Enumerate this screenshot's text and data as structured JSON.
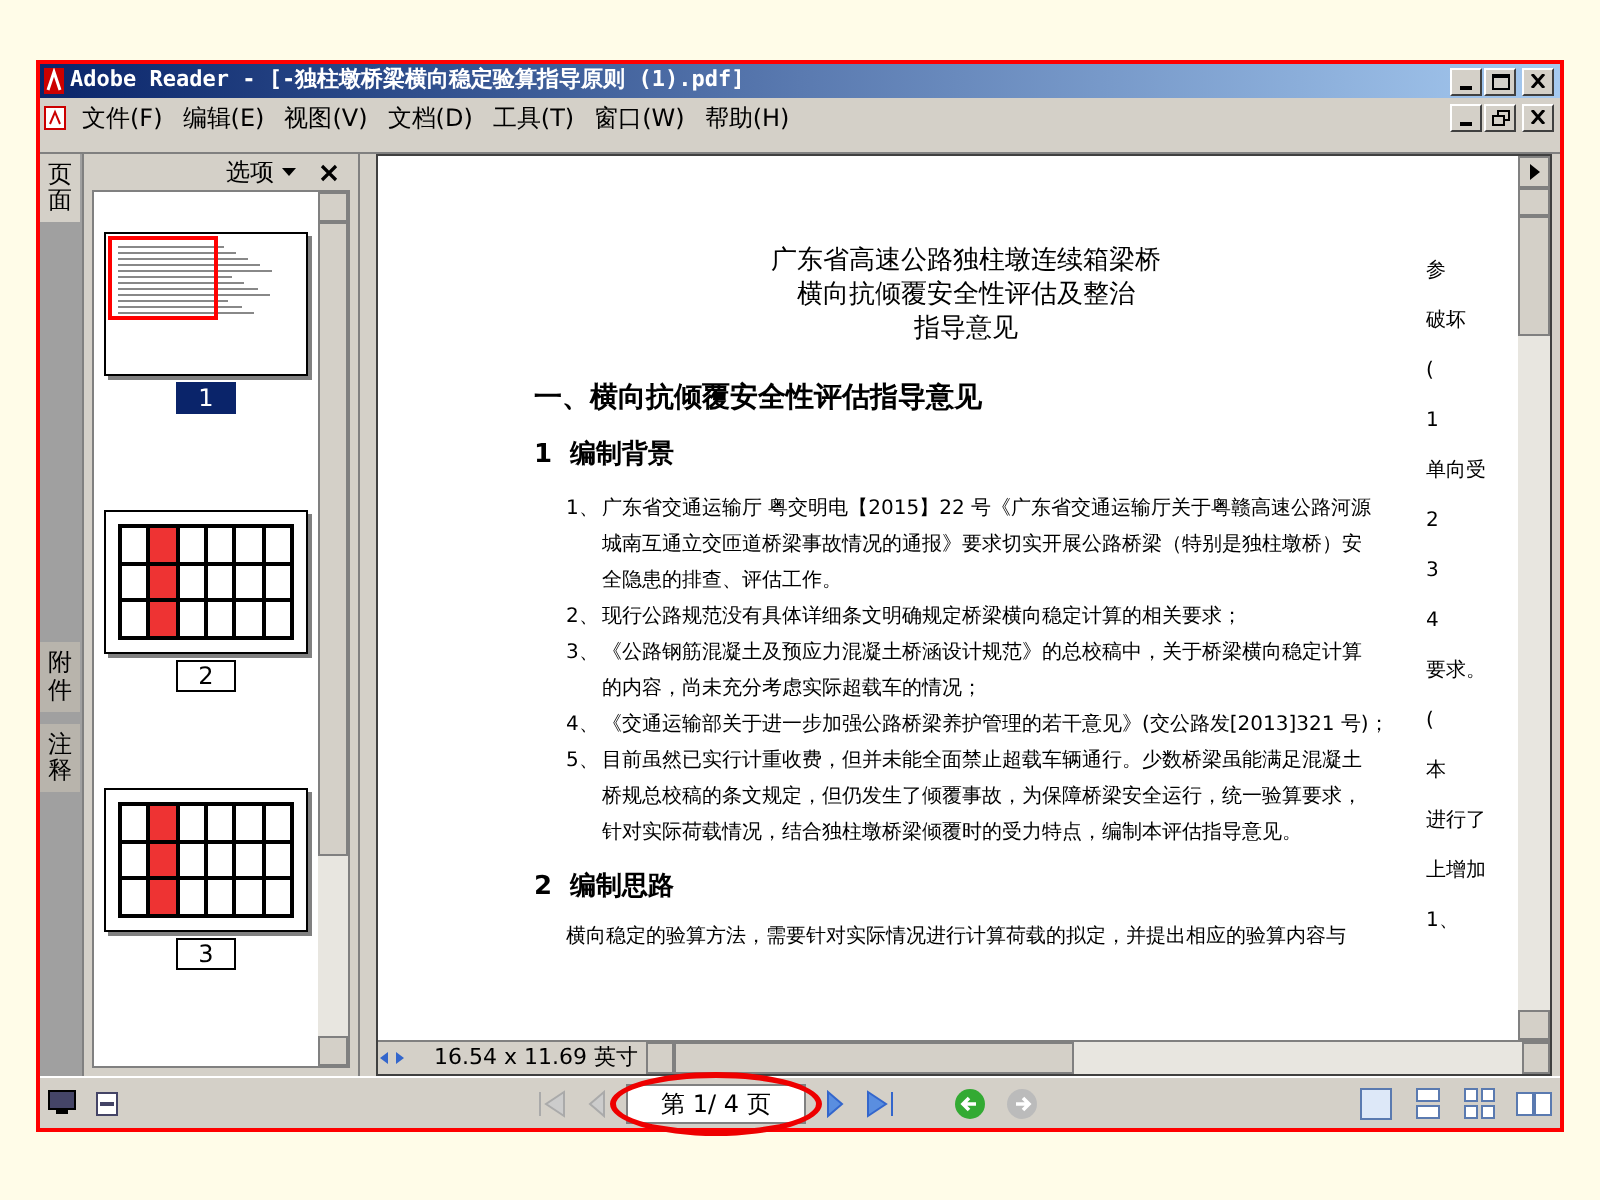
{
  "window": {
    "title": "Adobe Reader - [-独柱墩桥梁横向稳定验算指导原则 (1).pdf]"
  },
  "menu": {
    "items": [
      "文件(F)",
      "编辑(E)",
      "视图(V)",
      "文档(D)",
      "工具(T)",
      "窗口(W)",
      "帮助(H)"
    ]
  },
  "sidebar": {
    "tabs": [
      {
        "label": "页面",
        "selected": true
      },
      {
        "label": "附件",
        "selected": false
      },
      {
        "label": "注释",
        "selected": false
      }
    ],
    "options": "选项",
    "thumbnails": [
      {
        "label": "1",
        "selected": true,
        "kind": "text"
      },
      {
        "label": "2",
        "selected": false,
        "kind": "table"
      },
      {
        "label": "3",
        "selected": false,
        "kind": "table"
      }
    ]
  },
  "document": {
    "title_lines": [
      "广东省高速公路独柱墩连续箱梁桥",
      "横向抗倾覆安全性评估及整治",
      "指导意见"
    ],
    "heading": "一、横向抗倾覆安全性评估指导意见",
    "section_1": "1  编制背景",
    "items": [
      {
        "number": "1、",
        "lines": [
          "广东省交通运输厅 粤交明电【2015】22 号《广东省交通运输厅关于粤赣高速公路河源",
          "城南互通立交匝道桥梁事故情况的通报》要求切实开展公路桥梁（特别是独柱墩桥）安",
          "全隐患的排查、评估工作。"
        ]
      },
      {
        "number": "2、",
        "lines": [
          "现行公路规范没有具体详细条文明确规定桥梁横向稳定计算的相关要求；"
        ]
      },
      {
        "number": "3、",
        "lines": [
          "《公路钢筋混凝土及预应力混凝土桥涵设计规范》的总校稿中，关于桥梁横向稳定计算",
          "的内容，尚未充分考虑实际超载车的情况；"
        ]
      },
      {
        "number": "4、",
        "lines": [
          "《交通运输部关于进一步加强公路桥梁养护管理的若干意见》(交公路发[2013]321 号)；"
        ]
      },
      {
        "number": "5、",
        "lines": [
          "目前虽然已实行计重收费，但并未能全面禁止超载车辆通行。少数桥梁虽能满足混凝土",
          "桥规总校稿的条文规定，但仍发生了倾覆事故，为保障桥梁安全运行，统一验算要求，",
          "针对实际荷载情况，结合独柱墩桥梁倾覆时的受力特点，编制本评估指导意见。"
        ]
      }
    ],
    "section_2": "2  编制思路",
    "paragraph": "横向稳定的验算方法，需要针对实际情况进行计算荷载的拟定，并提出相应的验算内容与",
    "next_page_fragments": [
      "参",
      "破坏",
      "(",
      "1",
      "单向受",
      "2",
      "3",
      "4",
      "要求。",
      "(",
      "本",
      "进行了",
      "上增加",
      "1、"
    ]
  },
  "status_bar": {
    "page_size": "16.54 x 11.69 英寸"
  },
  "navigation": {
    "page_field": "第 1/ 4 页"
  }
}
